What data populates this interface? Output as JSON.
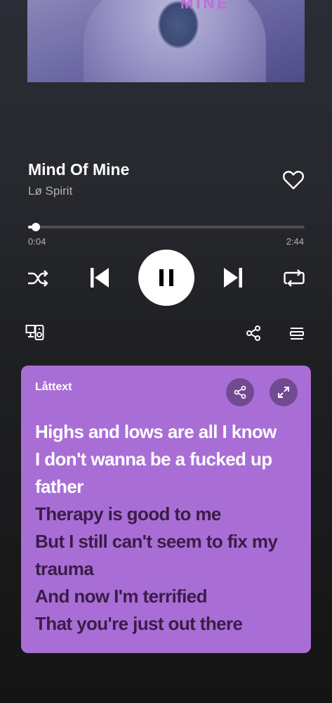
{
  "album_art": {
    "visible_text": "MINE"
  },
  "track": {
    "title": "Mind Of Mine",
    "artist": "Lø Spirit"
  },
  "progress": {
    "elapsed": "0:04",
    "total": "2:44",
    "fraction": 0.028
  },
  "icons": {
    "like": "heart-outline-icon",
    "shuffle": "shuffle-icon",
    "previous": "skip-previous-icon",
    "pause": "pause-icon",
    "next": "skip-next-icon",
    "repeat": "repeat-icon",
    "devices": "connect-device-icon",
    "share": "share-icon",
    "queue": "queue-icon",
    "expand": "expand-icon"
  },
  "lyrics": {
    "label": "Låttext",
    "lines": [
      {
        "text": "Highs and lows are all I know",
        "state": "active"
      },
      {
        "text": "I don't wanna be a fucked up",
        "state": "active"
      },
      {
        "text": "father",
        "state": "active"
      },
      {
        "text": "Therapy is good to me",
        "state": "upcoming"
      },
      {
        "text": "But I still can't seem to fix my",
        "state": "upcoming"
      },
      {
        "text": "trauma",
        "state": "upcoming"
      },
      {
        "text": "And now I'm terrified",
        "state": "upcoming"
      },
      {
        "text": "That you're just out there",
        "state": "upcoming"
      }
    ]
  },
  "colors": {
    "lyrics_card": "#a86ed6",
    "lyric_active": "#ffffff",
    "lyric_upcoming": "#3b1c47",
    "secondary_text": "#b3b3b3"
  }
}
